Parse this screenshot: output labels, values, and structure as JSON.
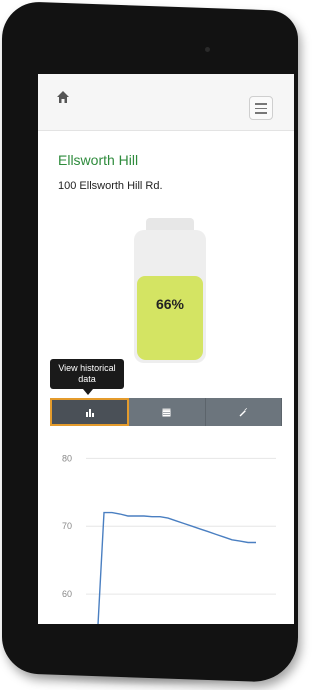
{
  "header": {
    "home_icon": "home-icon",
    "menu_icon": "hamburger-menu-icon"
  },
  "site": {
    "name": "Ellsworth Hill",
    "address": "100 Ellsworth Hill Rd."
  },
  "tank": {
    "level_percent": 66,
    "level_label": "66%",
    "fill_color": "#d4e463"
  },
  "tooltip": {
    "text": "View historical data"
  },
  "tabs": [
    {
      "icon": "bar-chart-icon",
      "active": true
    },
    {
      "icon": "calendar-icon",
      "active": false
    },
    {
      "icon": "wrench-icon",
      "active": false
    }
  ],
  "colors": {
    "title_green": "#2e8b3c",
    "tab_active_border": "#e49b2c",
    "tab_bg": "#6c757d",
    "line": "#4a7fc1"
  },
  "chart_data": {
    "type": "line",
    "ylim": [
      55,
      83
    ],
    "yticks": [
      80,
      70,
      60
    ],
    "grid": true,
    "series": [
      {
        "x": [
          0,
          1,
          2,
          3,
          4,
          5,
          6,
          7,
          8,
          9,
          10,
          11,
          12,
          13,
          14,
          15,
          16,
          17,
          18,
          19,
          20
        ],
        "values": [
          50,
          72,
          72,
          71.8,
          71.5,
          71.5,
          71.5,
          71.4,
          71.4,
          71.2,
          70.8,
          70.4,
          70,
          69.6,
          69.2,
          68.8,
          68.4,
          68,
          67.8,
          67.6,
          67.6
        ]
      }
    ]
  }
}
